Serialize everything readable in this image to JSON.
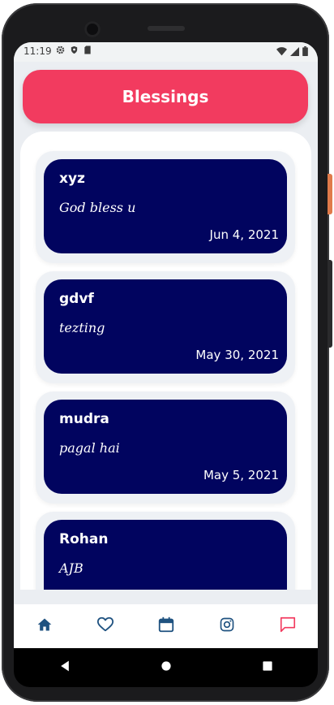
{
  "status_bar": {
    "time": "11:19",
    "left_icons": [
      "settings-icon",
      "shield-icon",
      "sd-card-icon"
    ],
    "right_icons": [
      "wifi-icon",
      "signal-icon",
      "battery-icon"
    ]
  },
  "header": {
    "title": "Blessings",
    "color": "#f23b5f"
  },
  "blessings": [
    {
      "name": "xyz",
      "message": "God bless u",
      "date": "Jun 4, 2021"
    },
    {
      "name": "gdvf",
      "message": "tezting",
      "date": "May 30, 2021"
    },
    {
      "name": "mudra",
      "message": "pagal hai",
      "date": "May 5, 2021"
    },
    {
      "name": "Rohan",
      "message": "AJB",
      "date": ""
    }
  ],
  "card_color": "#01045f",
  "bottom_nav": [
    {
      "icon": "home-icon",
      "active": false
    },
    {
      "icon": "heart-icon",
      "active": false
    },
    {
      "icon": "calendar-icon",
      "active": false
    },
    {
      "icon": "instagram-icon",
      "active": false
    },
    {
      "icon": "chat-icon",
      "active": true
    }
  ],
  "system_nav": [
    "back-icon",
    "home-circle-icon",
    "recents-icon"
  ]
}
